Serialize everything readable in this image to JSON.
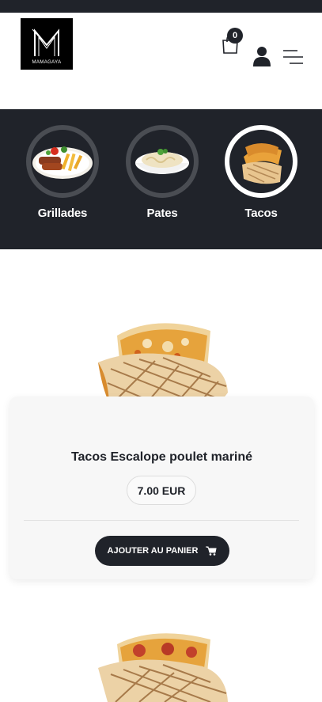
{
  "header": {
    "logo_text": "MAMAGAYA",
    "cart_count": "0"
  },
  "icons": {
    "cart": "shopping-bag-icon",
    "user": "user-icon",
    "menu": "menu-icon",
    "add_to_cart": "cart-icon"
  },
  "categories": [
    {
      "label": "Grillades",
      "active": false
    },
    {
      "label": "Pates",
      "active": false
    },
    {
      "label": "Tacos",
      "active": true
    }
  ],
  "product": {
    "title": "Tacos Escalope poulet mariné",
    "price": "7.00 EUR",
    "add_label": "AJOUTER AU PANIER"
  },
  "colors": {
    "dark": "#20232a",
    "ring": "#4a4d53",
    "active_ring": "#ffffff"
  }
}
